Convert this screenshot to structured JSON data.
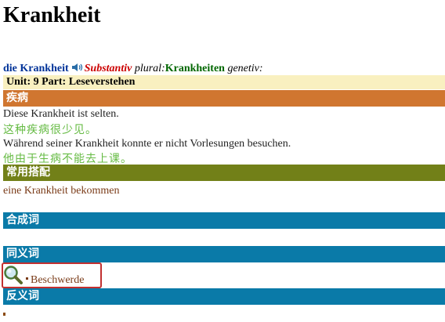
{
  "title": "Krankheit",
  "headline": {
    "word": "die Krankheit",
    "pos": "Substantiv",
    "plural_label": "plural:",
    "plural_value": "Krankheiten",
    "genitive_label": "genetiv:"
  },
  "unit": "Unit: 9   Part: Leseverstehen",
  "sections": {
    "meaning_label": "疾病",
    "examples": [
      {
        "de": "Diese Krankheit ist selten.",
        "zh": "这种疾病很少见。"
      },
      {
        "de": "Während seiner Krankheit konnte er nicht Vorlesungen besuchen.",
        "zh": "他由于生病不能去上课。"
      }
    ],
    "collocations_label": "常用搭配",
    "collocations": [
      "eine Krankheit bekommen"
    ],
    "compounds_label": "合成词",
    "synonyms_label": "同义词",
    "synonyms": [
      "Beschwerde"
    ],
    "antonyms_label": "反义词"
  },
  "icons": {
    "speaker": "speaker-icon",
    "search": "magnifier-icon"
  },
  "colors": {
    "orange_bar": "#d07630",
    "olive_bar": "#728018",
    "blue_bar": "#0a7aa8",
    "unit_bar": "#f9f0c0",
    "chinese_text": "#66bb44",
    "highlight_box": "#c23030"
  }
}
